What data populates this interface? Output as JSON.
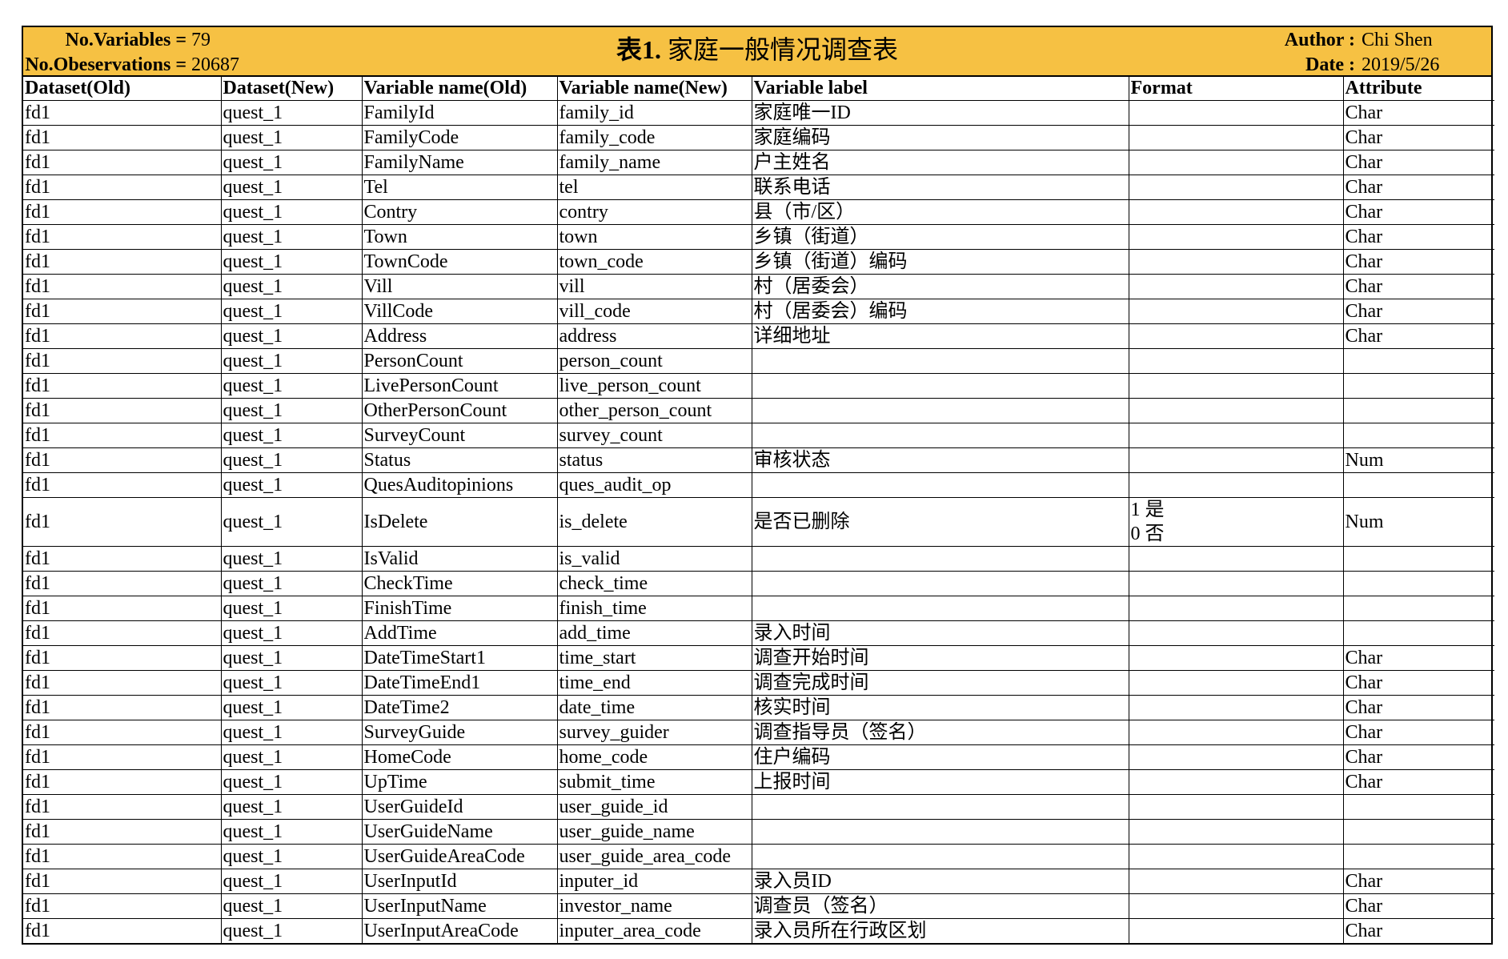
{
  "header": {
    "variables_label": "No.Variables =",
    "variables_value": "79",
    "observations_label": "No.Obeservations =",
    "observations_value": "20687",
    "title_number": "表1.",
    "title_text": "家庭一般情况调查表",
    "author_label": "Author :",
    "author_value": "Chi Shen",
    "date_label": "Date :",
    "date_value": "2019/5/26"
  },
  "columns": [
    "Dataset(Old)",
    "Dataset(New)",
    "Variable name(Old)",
    "Variable name(New)",
    "Variable label",
    "Format",
    "Attribute"
  ],
  "rows": [
    [
      "fd1",
      "quest_1",
      "FamilyId",
      "family_id",
      "家庭唯一ID",
      "",
      "Char"
    ],
    [
      "fd1",
      "quest_1",
      "FamilyCode",
      "family_code",
      "家庭编码",
      "",
      "Char"
    ],
    [
      "fd1",
      "quest_1",
      "FamilyName",
      "family_name",
      "户主姓名",
      "",
      "Char"
    ],
    [
      "fd1",
      "quest_1",
      "Tel",
      "tel",
      "联系电话",
      "",
      "Char"
    ],
    [
      "fd1",
      "quest_1",
      "Contry",
      "contry",
      "县（市/区）",
      "",
      "Char"
    ],
    [
      "fd1",
      "quest_1",
      "Town",
      "town",
      "乡镇（街道）",
      "",
      "Char"
    ],
    [
      "fd1",
      "quest_1",
      "TownCode",
      "town_code",
      "乡镇（街道）编码",
      "",
      "Char"
    ],
    [
      "fd1",
      "quest_1",
      "Vill",
      "vill",
      "村（居委会）",
      "",
      "Char"
    ],
    [
      "fd1",
      "quest_1",
      "VillCode",
      "vill_code",
      "村（居委会）编码",
      "",
      "Char"
    ],
    [
      "fd1",
      "quest_1",
      "Address",
      "address",
      "详细地址",
      "",
      "Char"
    ],
    [
      "fd1",
      "quest_1",
      "PersonCount",
      "person_count",
      "",
      "",
      ""
    ],
    [
      "fd1",
      "quest_1",
      "LivePersonCount",
      "live_person_count",
      "",
      "",
      ""
    ],
    [
      "fd1",
      "quest_1",
      "OtherPersonCount",
      "other_person_count",
      "",
      "",
      ""
    ],
    [
      "fd1",
      "quest_1",
      "SurveyCount",
      "survey_count",
      "",
      "",
      ""
    ],
    [
      "fd1",
      "quest_1",
      "Status",
      "status",
      "审核状态",
      "",
      "Num"
    ],
    [
      "fd1",
      "quest_1",
      "QuesAuditopinions",
      "ques_audit_op",
      "",
      "",
      ""
    ],
    [
      "fd1",
      "quest_1",
      "IsDelete",
      "is_delete",
      "是否已删除",
      [
        "1 是",
        "0 否"
      ],
      "Num"
    ],
    [
      "fd1",
      "quest_1",
      "IsValid",
      "is_valid",
      "",
      "",
      ""
    ],
    [
      "fd1",
      "quest_1",
      "CheckTime",
      "check_time",
      "",
      "",
      ""
    ],
    [
      "fd1",
      "quest_1",
      "FinishTime",
      "finish_time",
      "",
      "",
      ""
    ],
    [
      "fd1",
      "quest_1",
      "AddTime",
      "add_time",
      "录入时间",
      "",
      ""
    ],
    [
      "fd1",
      "quest_1",
      "DateTimeStart1",
      "time_start",
      "调查开始时间",
      "",
      "Char"
    ],
    [
      "fd1",
      "quest_1",
      "DateTimeEnd1",
      "time_end",
      "调查完成时间",
      "",
      "Char"
    ],
    [
      "fd1",
      "quest_1",
      "DateTime2",
      "date_time",
      "核实时间",
      "",
      "Char"
    ],
    [
      "fd1",
      "quest_1",
      "SurveyGuide",
      "survey_guider",
      "调查指导员（签名）",
      "",
      "Char"
    ],
    [
      "fd1",
      "quest_1",
      "HomeCode",
      "home_code",
      "住户编码",
      "",
      "Char"
    ],
    [
      "fd1",
      "quest_1",
      "UpTime",
      "submit_time",
      "上报时间",
      "",
      "Char"
    ],
    [
      "fd1",
      "quest_1",
      "UserGuideId",
      "user_guide_id",
      "",
      "",
      ""
    ],
    [
      "fd1",
      "quest_1",
      "UserGuideName",
      "user_guide_name",
      "",
      "",
      ""
    ],
    [
      "fd1",
      "quest_1",
      "UserGuideAreaCode",
      "user_guide_area_code",
      "",
      "",
      ""
    ],
    [
      "fd1",
      "quest_1",
      "UserInputId",
      "inputer_id",
      "录入员ID",
      "",
      "Char"
    ],
    [
      "fd1",
      "quest_1",
      "UserInputName",
      "investor_name",
      "调查员（签名）",
      "",
      "Char"
    ],
    [
      "fd1",
      "quest_1",
      "UserInputAreaCode",
      "inputer_area_code",
      "录入员所在行政区划",
      "",
      "Char"
    ]
  ],
  "colors": {
    "banner": "#f6c143",
    "grid": "#000000"
  }
}
